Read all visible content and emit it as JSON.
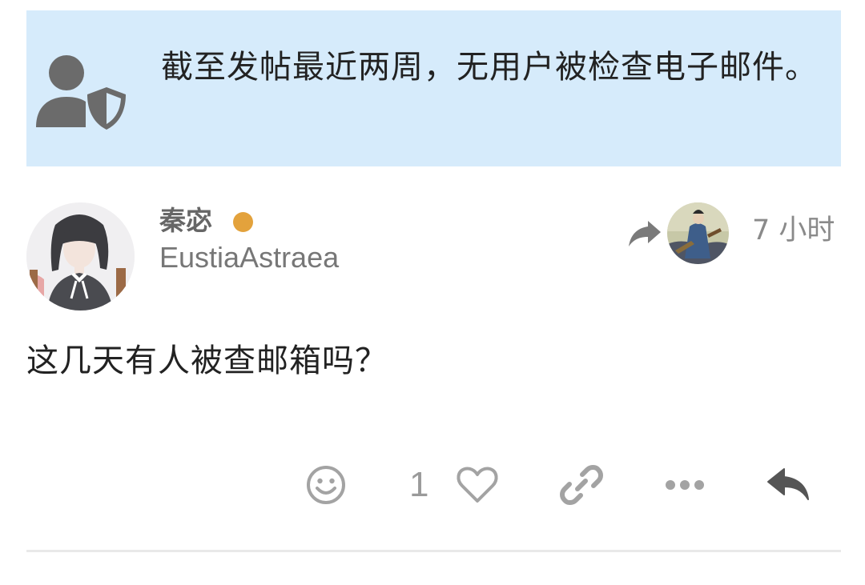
{
  "notice": {
    "icon": "user-shield-icon",
    "text": "截至发帖最近两周，无用户被检查电子邮件。"
  },
  "post": {
    "author": {
      "display_name": "秦宓",
      "username": "EustiaAstraea",
      "status_color": "#e3a23c"
    },
    "reply_to_icon": "share-arrow-icon",
    "time": "7 小时",
    "body": "这几天有人被查邮箱吗？",
    "actions": {
      "reaction_icon": "smiley-icon",
      "like_count": "1",
      "like_icon": "heart-icon",
      "link_icon": "link-icon",
      "more_icon": "ellipsis-icon",
      "reply_icon": "reply-icon"
    }
  },
  "colors": {
    "notice_bg": "#d6ebfb",
    "icon_gray": "#6b6b6b",
    "action_gray": "#a3a3a3"
  }
}
